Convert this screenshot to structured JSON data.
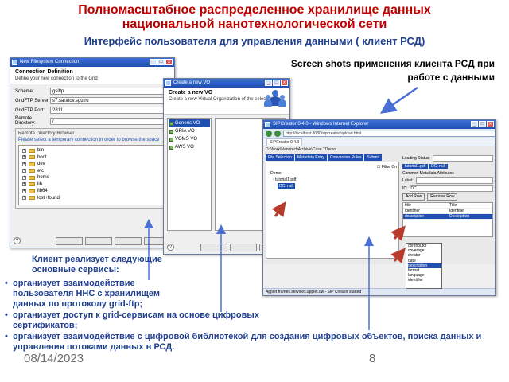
{
  "slide": {
    "title_line1": "Полномасштабное распределенное хранилище данных",
    "title_line2": "национальной нанотехнологической сети",
    "subtitle": "Интерфейс пользователя для управления данными ( клиент РСД)",
    "caption_line1": "Screen shots применения клиента РСД при",
    "caption_line2": "работе с данными",
    "intro_line1": "Клиент реализует следующие",
    "intro_line2": "основные сервисы:",
    "bullets": [
      {
        "line1": "организует взаимодействие",
        "line2": "пользователя ННС с хранилищем",
        "line3": "данных по протоколу grid-ftp;"
      },
      {
        "line1": "организует доступ к grid-сервисам на основе цифровых",
        "line2": "сертификатов;"
      },
      {
        "line1": "организует взаимодействие с цифровой библиотекой для создания цифровых объектов, поиска данных и",
        "line2": "управления потоками данных в РСД."
      }
    ],
    "date": "08/14/2023",
    "page_number": "8"
  },
  "win1": {
    "title": "New Filesystem Connection",
    "header": "Connection Definition",
    "description": "Define your new connection to the Grid",
    "fields": [
      {
        "label": "Scheme:",
        "value": "gsiftp"
      },
      {
        "label": "GridFTP Server:",
        "value": "s7.saratov.sgu.ru"
      },
      {
        "label": "GridFTP Port:",
        "value": "2811"
      },
      {
        "label": "Remote Directory:",
        "value": "/"
      }
    ],
    "browser_title": "Remote Directory Browser",
    "browser_link": "Please select a temporary connection in order to browse the space",
    "tree": [
      "bin",
      "boot",
      "dev",
      "etc",
      "home",
      "lib",
      "lib64",
      "lost+found"
    ]
  },
  "win2": {
    "title": "Create a new VO",
    "header": "Create a new VO",
    "description": "Create a new Virtual Organization of the selected type.",
    "vo_list": [
      "Generic VO",
      "GRIA VO",
      "VOMS VO",
      "AWS VO"
    ]
  },
  "win3": {
    "title": "SIPCreator 0.4.0 - Windows Internet Explorer",
    "address": "http://localhost:8080/sipcreator/upload.html",
    "tab": "SIPCreator 0.4.0",
    "path": "D:\\Work\\NanotechArchive\\Case TDemo",
    "tabs": [
      "File Selection",
      "Metadata Entry",
      "Conversion Rules",
      "Submit"
    ],
    "filter_label": "Filter On",
    "tree": [
      "Demo",
      "tutorial1.pdf",
      "DC: null"
    ],
    "loading_status": "Loading Status:",
    "right_tabs": [
      "tutorial1.pdf",
      "DC: null"
    ],
    "section": "Common Metadata Attributes",
    "label_field": "Label:",
    "id_field": "ID:",
    "id_value": "DC",
    "add_row": "Add Row",
    "remove_row": "Remove Row",
    "table_rows": [
      {
        "name": "title",
        "value": "Title"
      },
      {
        "name": "identifier",
        "value": "Identifier"
      },
      {
        "name": "description",
        "value": "Description"
      }
    ],
    "dropdown": [
      "contributor",
      "coverage",
      "creator",
      "date",
      "description",
      "format",
      "language",
      "identifier"
    ],
    "status": "Applet frames.services.applet.cw - SIP Creator started"
  }
}
